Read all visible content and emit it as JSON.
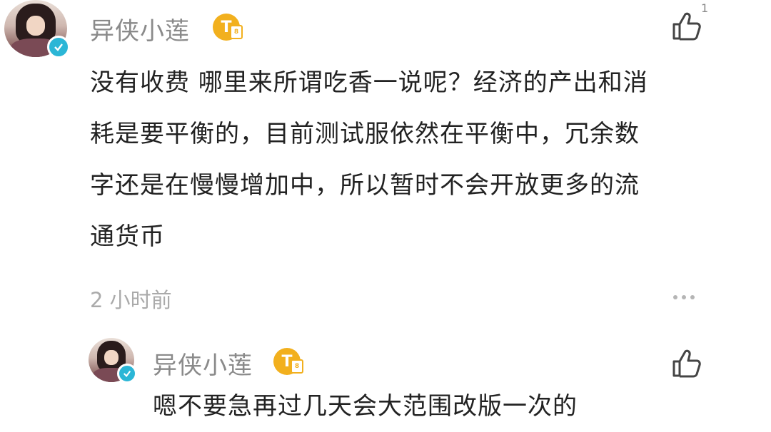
{
  "comment": {
    "username": "异侠小莲",
    "level_badge": "T",
    "like_count": "1",
    "lines": [
      "没有收费 哪里来所谓吃香一说呢？经济的产出和消",
      "耗是要平衡的，目前测试服依然在平衡中，冗余数",
      "字还是在慢慢增加中，所以暂时不会开放更多的流",
      "通货币"
    ],
    "time": "2 小时前"
  },
  "reply": {
    "username": "异侠小莲",
    "level_badge": "T",
    "text": "嗯不要急再过几天会大范围改版一次的"
  },
  "icons": {
    "like": "thumbs-up-icon",
    "more": "more-dots-icon",
    "verified": "verified-check-icon"
  }
}
